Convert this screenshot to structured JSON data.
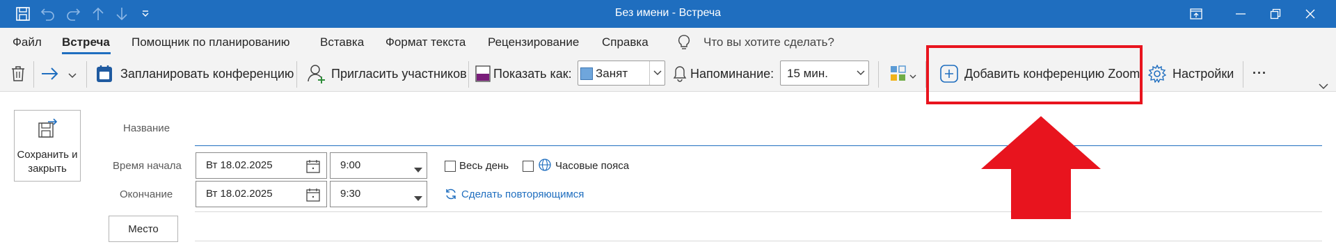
{
  "window": {
    "title": "Без имени  -  Встреча"
  },
  "tabs": [
    {
      "label": "Файл"
    },
    {
      "label": "Встреча",
      "active": true
    },
    {
      "label": "Помощник по планированию"
    },
    {
      "label": "Вставка"
    },
    {
      "label": "Формат текста"
    },
    {
      "label": "Рецензирование"
    },
    {
      "label": "Справка"
    }
  ],
  "tell_me": {
    "placeholder": "Что вы хотите сделать?"
  },
  "ribbon": {
    "schedule_conference": "Запланировать конференцию",
    "invite_attendees": "Пригласить участников",
    "show_as_label": "Показать как:",
    "show_as_value": "Занят",
    "reminder_label": "Напоминание:",
    "reminder_value": "15 мин.",
    "zoom_add": "Добавить конференцию Zoom",
    "settings": "Настройки",
    "more": "..."
  },
  "form": {
    "save_close": "Сохранить и закрыть",
    "title_placeholder": "Название",
    "start_label": "Время начала",
    "start_date": "Вт 18.02.2025",
    "start_time": "9:00",
    "all_day": "Весь день",
    "time_zones": "Часовые пояса",
    "end_label": "Окончание",
    "end_date": "Вт 18.02.2025",
    "end_time": "9:30",
    "recurring": "Сделать повторяющимся",
    "location_button": "Место"
  },
  "colors": {
    "titlebar": "#1f6ebf",
    "accent": "#1f6ebf",
    "annotation": "#e8141e",
    "busy_swatch": "#6fa6dc"
  }
}
